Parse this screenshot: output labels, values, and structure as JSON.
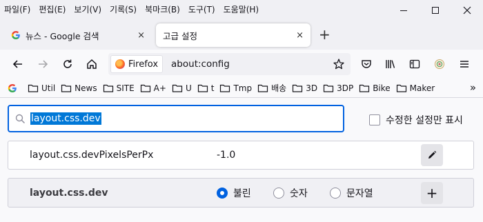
{
  "menu": [
    "파일(F)",
    "편집(E)",
    "보기(V)",
    "기록(S)",
    "북마크(B)",
    "도구(T)",
    "도움말(H)"
  ],
  "tabs": [
    {
      "label": "뉴스 - Google 검색",
      "close": "×"
    },
    {
      "label": "고급 설정",
      "close": "×"
    }
  ],
  "newtab": "+",
  "urlbar": {
    "identity": "Firefox",
    "url": "about:config"
  },
  "bookmarks": [
    "Util",
    "News",
    "SITE",
    "A+",
    "U",
    "t",
    "Tmp",
    "배송",
    "3D",
    "3DP",
    "Bike",
    "Maker"
  ],
  "bookmarks_more": "»",
  "search": {
    "value": "layout.css.dev"
  },
  "modified_only": {
    "label": "수정한 설정만 표시",
    "checked": false
  },
  "prefs": [
    {
      "name": "layout.css.devPixelsPerPx",
      "value": "-1.0"
    },
    {
      "name": "layout.css.dev",
      "types": [
        "불린",
        "숫자",
        "문자열"
      ],
      "selected": "불린",
      "add": "+"
    }
  ],
  "colors": {
    "accent": "#0061e0",
    "selection": "#0078d7"
  }
}
